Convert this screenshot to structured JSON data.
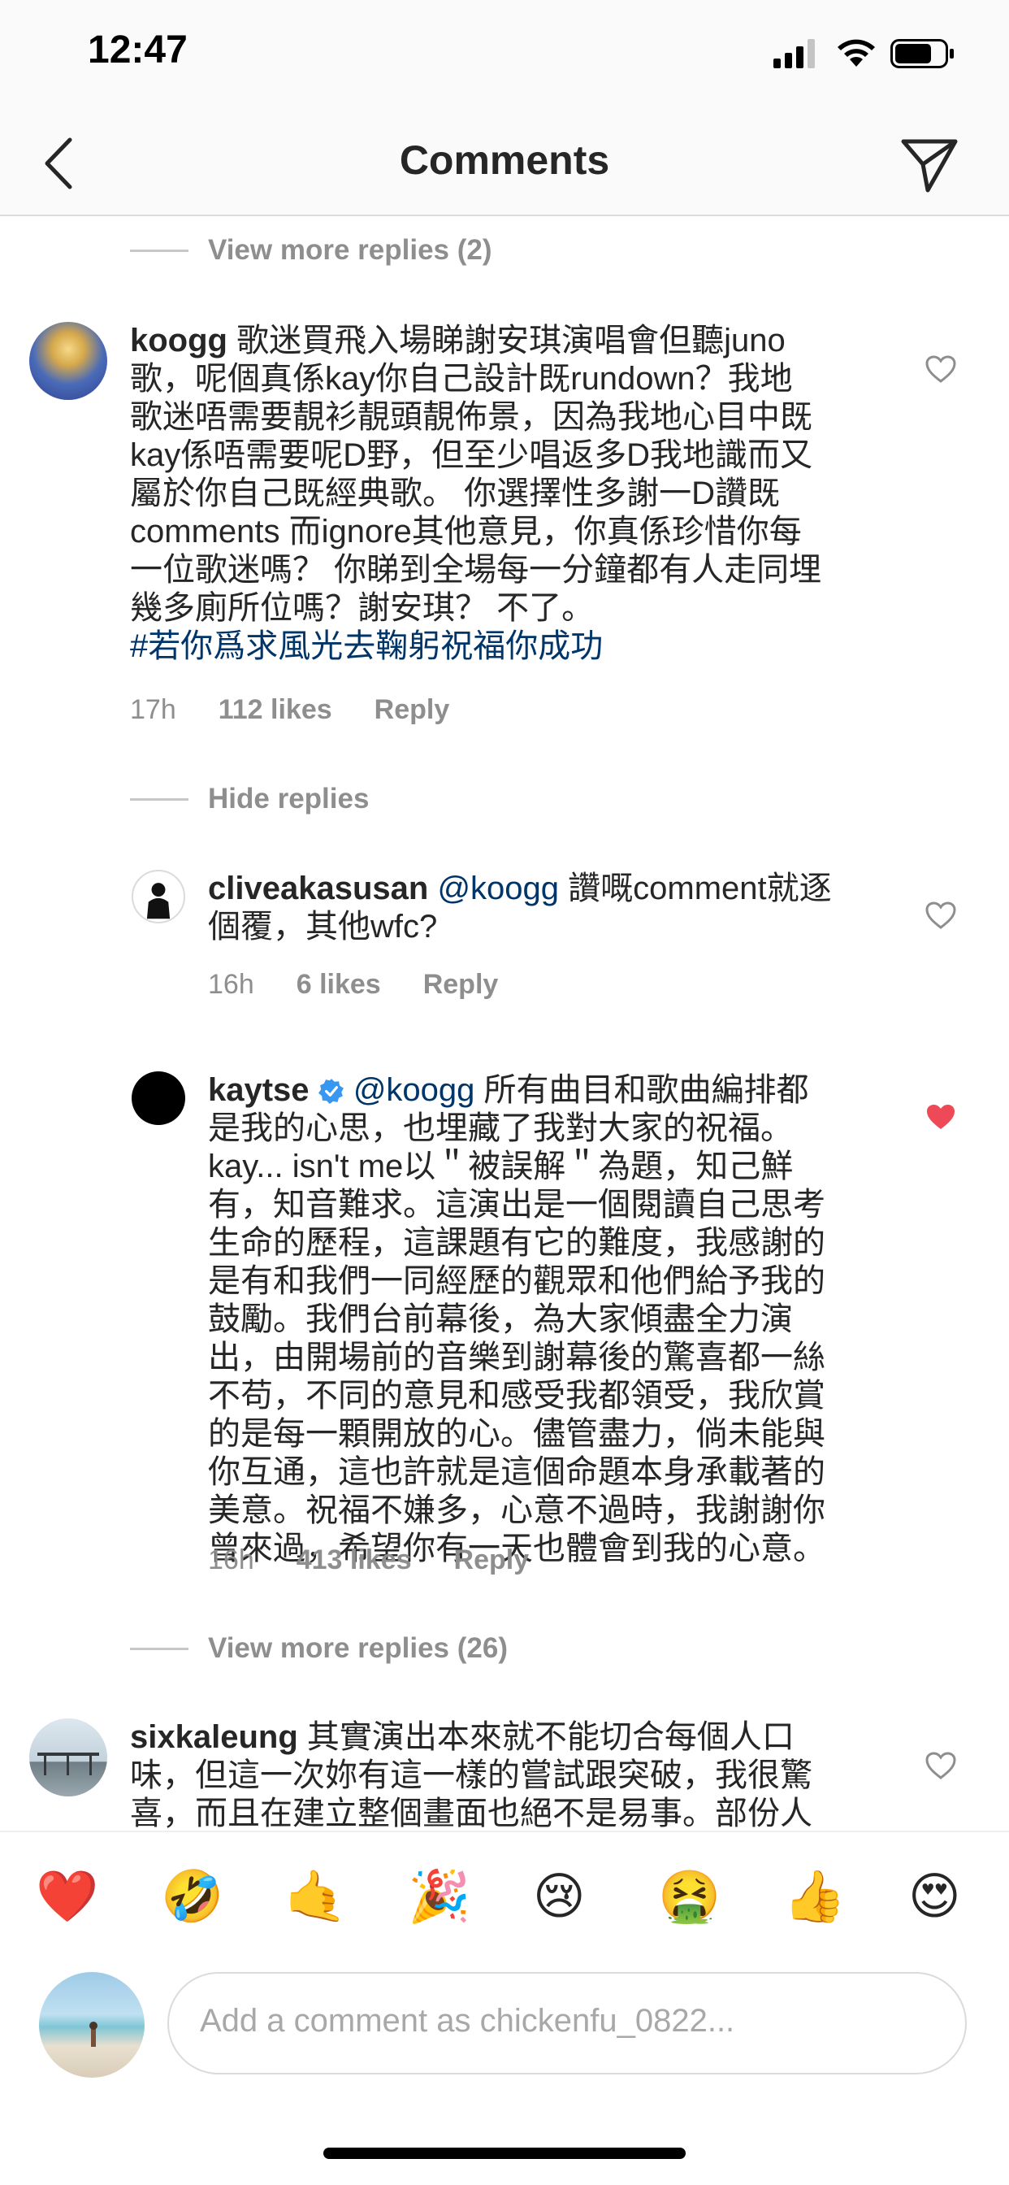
{
  "status_bar": {
    "time": "12:47"
  },
  "header": {
    "title": "Comments"
  },
  "view_more_top": "View more replies (2)",
  "comment1": {
    "username": "koogg",
    "text": "歌迷買飛入場睇謝安琪演唱會但聽juno",
    "lines": [
      "歌，呢個真係kay你自己設計既rundown？我地",
      "歌迷唔需要靚衫靚頭靚佈景，因為我地心目中既",
      "kay係唔需要呢D野，但至少唱返多D我地識而又",
      "屬於你自己既經典歌。 你選擇性多謝一D讚既",
      "comments 而ignore其他意見，你真係珍惜你每",
      "一位歌迷嗎？ 你睇到全場每一分鐘都有人走同埋",
      "幾多廁所位嗎？謝安琪？ 不了。"
    ],
    "hashtag": "#若你爲求風光去鞠躬祝福你成功",
    "time": "17h",
    "likes": "112 likes",
    "reply": "Reply"
  },
  "hide_replies": "Hide replies",
  "reply1": {
    "username": "cliveakasusan",
    "mention": "@koogg",
    "text_first": " 讚嘅comment就逐",
    "text_second": "個覆，其他wfc?",
    "time": "16h",
    "likes": "6 likes",
    "reply": "Reply"
  },
  "reply2": {
    "username": "kaytse",
    "mention": "@koogg",
    "text_first": " 所有曲目和歌曲編排都",
    "lines": [
      "是我的心思，也埋藏了我對大家的祝福。",
      "kay... isn't me以＂被誤解＂為題，知己鮮",
      "有，知音難求。這演出是一個閱讀自己思考",
      "生命的歷程，這課題有它的難度，我感謝的",
      "是有和我們一同經歷的觀眾和他們給予我的",
      "鼓勵。我們台前幕後，為大家傾盡全力演",
      "出，由開場前的音樂到謝幕後的驚喜都一絲",
      "不苟，不同的意見和感受我都領受，我欣賞",
      "的是每一顆開放的心。儘管盡力，倘未能與",
      "你互通，這也許就是這個命題本身承載著的",
      "美意。祝福不嫌多，心意不過時，我謝謝你",
      "曾來過，希望你有一天也體會到我的心意。"
    ],
    "time": "16h",
    "likes": "413 likes",
    "reply": "Reply"
  },
  "view_more_bottom": "View more replies (26)",
  "comment2": {
    "username": "sixkaleung",
    "text_first": " 其實演出本來就不能切合每個人口",
    "lines": [
      "味，但這一次妳有這一樣的嘗試跟突破，我很驚",
      "喜，而且在建立整個畫面也絕不是易事。部份人"
    ]
  },
  "reactions": [
    "❤️",
    "🤣",
    "🤙",
    "🎉",
    "😢",
    "🤮",
    "👍",
    "😍"
  ],
  "composer": {
    "placeholder": "Add a comment as chickenfu_0822..."
  },
  "colors": {
    "liked_heart": "#ed4956",
    "link": "#003569",
    "muted": "#8e8e8e"
  }
}
